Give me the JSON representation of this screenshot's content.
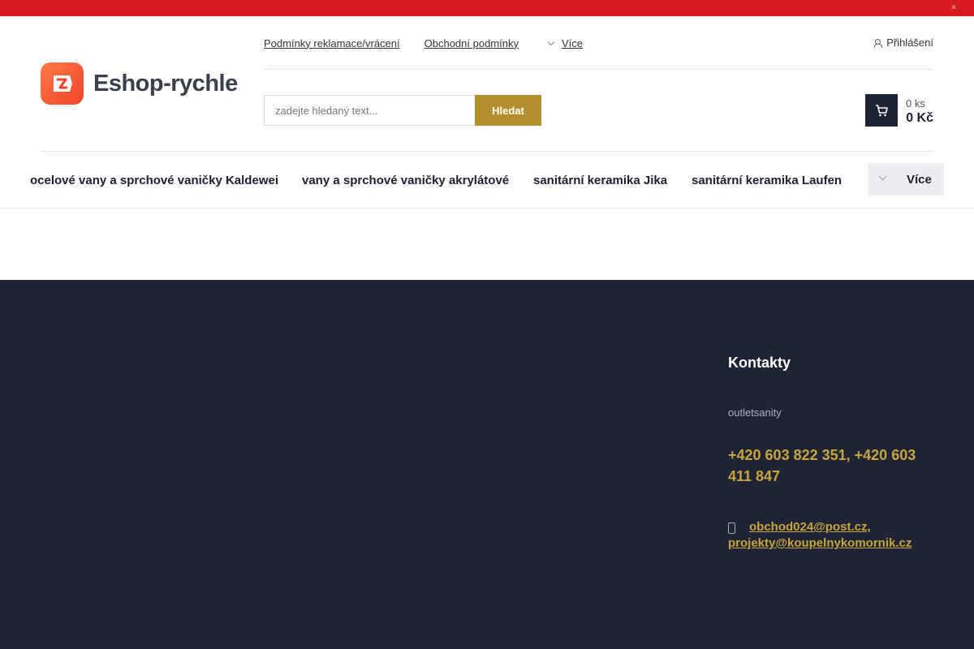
{
  "top_bar": {
    "color": "#d71921",
    "close_icon": "close-icon"
  },
  "logo": {
    "text": "Eshop-rychle",
    "icon": "tag-icon"
  },
  "top_links": [
    {
      "label": "Podmínky reklamace/vrácení"
    },
    {
      "label": "Obchodní podmínky"
    }
  ],
  "top_more": {
    "label": "Více",
    "icon": "chevron-down-icon"
  },
  "login": {
    "label": "Přihlášení",
    "icon": "user-icon"
  },
  "search": {
    "placeholder": "zadejte hledaný text...",
    "value": "",
    "button_label": "Hledat",
    "button_color": "#b58f2c"
  },
  "cart": {
    "quantity": "0 ks",
    "price": "0 Kč",
    "icon": "cart-icon"
  },
  "nav": {
    "items": [
      {
        "label": "ocelové vany a sprchové vaničky Kaldewei"
      },
      {
        "label": "vany a sprchové vaničky akrylátové"
      },
      {
        "label": "sanitární keramika Jika"
      },
      {
        "label": "sanitární keramika Laufen"
      }
    ],
    "more_label": "Více"
  },
  "footer": {
    "background": "#1e2436",
    "contacts_title": "Kontakty",
    "company": "outletsanity",
    "phone": "+420 603 822 351, +420 603 411 847",
    "email_line1": "obchod024@post.cz,",
    "email_line2": "projekty@koupelnykomornik.cz",
    "accent": "#c9a43c"
  }
}
